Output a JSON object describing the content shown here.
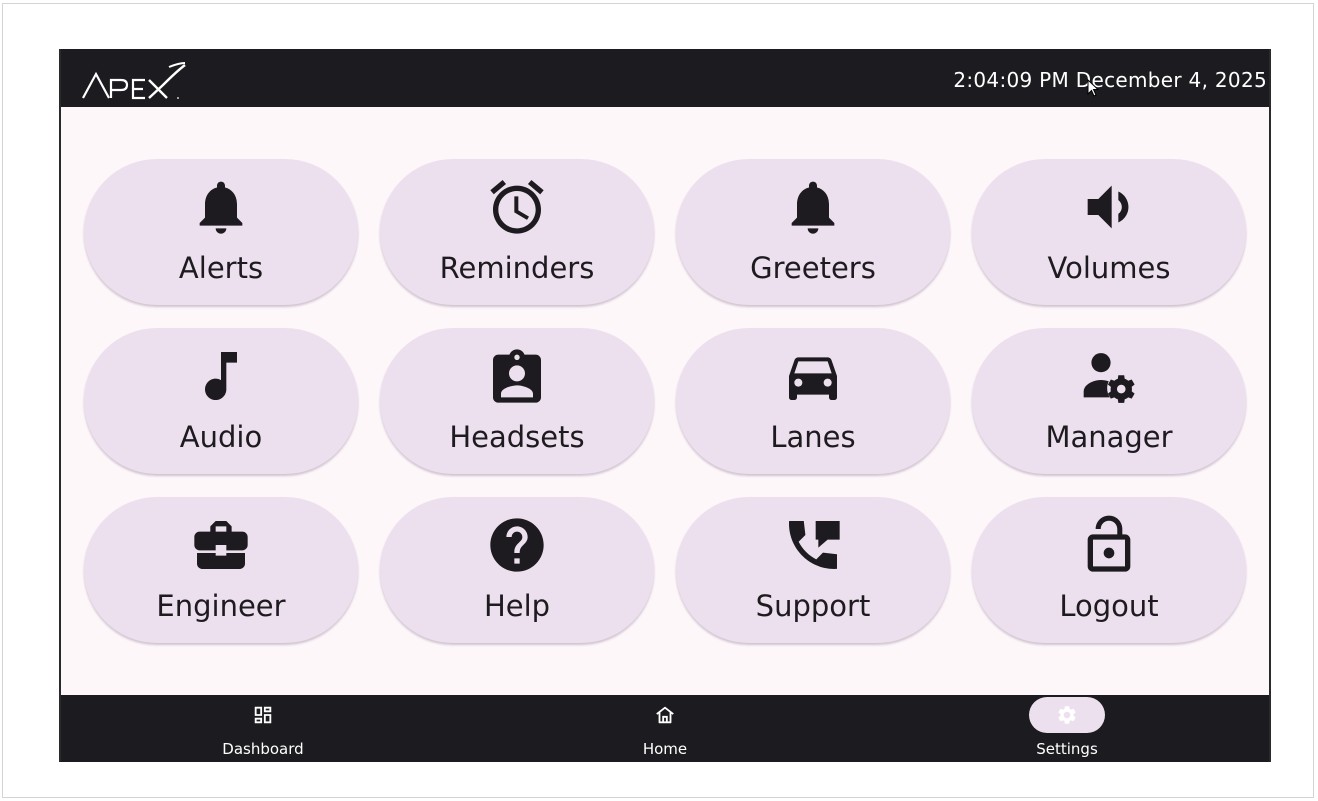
{
  "header": {
    "logo_text": "APEX",
    "time": "2:04:09 PM",
    "date": "December 4, 2025"
  },
  "tiles": [
    {
      "label": "Alerts",
      "icon": "bell-icon"
    },
    {
      "label": "Reminders",
      "icon": "alarm-clock-icon"
    },
    {
      "label": "Greeters",
      "icon": "bell-icon"
    },
    {
      "label": "Volumes",
      "icon": "volume-icon"
    },
    {
      "label": "Audio",
      "icon": "music-note-icon"
    },
    {
      "label": "Headsets",
      "icon": "id-badge-icon"
    },
    {
      "label": "Lanes",
      "icon": "car-icon"
    },
    {
      "label": "Manager",
      "icon": "user-gear-icon"
    },
    {
      "label": "Engineer",
      "icon": "toolbox-icon"
    },
    {
      "label": "Help",
      "icon": "help-circle-icon"
    },
    {
      "label": "Support",
      "icon": "phone-chat-icon"
    },
    {
      "label": "Logout",
      "icon": "lock-open-icon"
    }
  ],
  "nav": {
    "items": [
      {
        "label": "Dashboard",
        "icon": "dashboard-icon",
        "active": false
      },
      {
        "label": "Home",
        "icon": "home-icon",
        "active": false
      },
      {
        "label": "Settings",
        "icon": "gear-icon",
        "active": true
      }
    ]
  },
  "colors": {
    "bar": "#1c1b1f",
    "content_bg": "#fdf7fa",
    "tile_bg": "#ede0ee",
    "icon": "#1d1b20",
    "active_pill": "#ede0ee"
  }
}
